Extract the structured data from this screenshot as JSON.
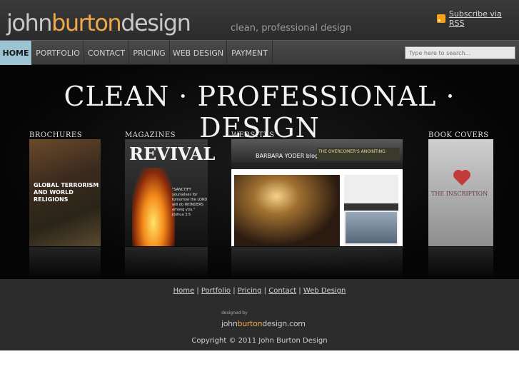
{
  "header": {
    "logo_john": "john",
    "logo_burton": "burton",
    "logo_design": "design",
    "tagline": "clean, professional design",
    "rss_label": "Subscribe via RSS"
  },
  "nav": {
    "items": [
      {
        "label": "HOME",
        "active": true
      },
      {
        "label": "PORTFOLIO"
      },
      {
        "label": "CONTACT"
      },
      {
        "label": "PRICING"
      },
      {
        "label": "WEB DESIGN"
      },
      {
        "label": "PAYMENT"
      }
    ],
    "search_placeholder": "Type here to search..."
  },
  "hero": {
    "title": "CLEAN · PROFESSIONAL · DESIGN",
    "categories": [
      "BROCHURES",
      "MAGAZINES",
      "WEBSITES",
      "BOOK COVERS"
    ],
    "brochure_text": "GLOBAL TERRORISM AND WORLD RELIGIONS",
    "magazine_title": "REVIVAL",
    "magazine_quote": "\"SANCTIFY yourselves for tomorrow the LORD will do WONDERS among you.\" Joshua 3:5",
    "website_brand": "BARBARA YODER blog",
    "website_banner": "THE OVERCOMER'S ANOINTING",
    "book_title": "THE INSCRIPTION"
  },
  "footer": {
    "links": [
      "Home",
      "Portfolio",
      "Pricing",
      "Contact",
      "Web Design"
    ],
    "designed_by": "designed by",
    "designed_logo_a": "john",
    "designed_logo_b": "burton",
    "designed_logo_c": "design.com",
    "copyright": "Copyright © 2011 John Burton Design"
  },
  "colors": {
    "accent_orange": "#f0a94a",
    "nav_active": "#9cc4d2",
    "rss_orange": "#f5a21b"
  }
}
